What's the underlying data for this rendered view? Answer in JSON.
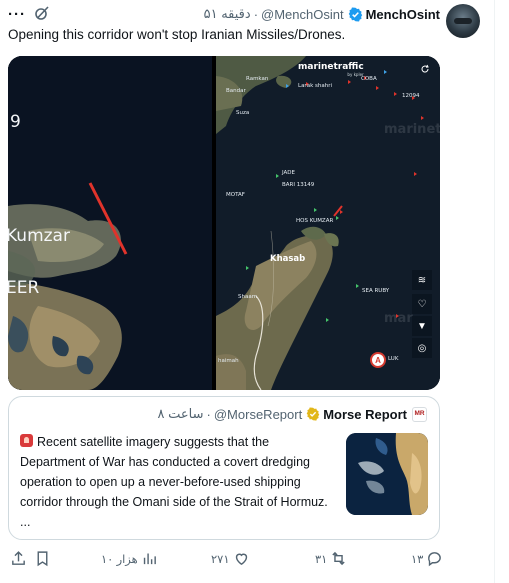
{
  "author": {
    "name": "MenchOsint",
    "handle": "@MenchOsint",
    "time": "۵۱ دقیقه",
    "separator": "·"
  },
  "more_label": "···",
  "tweet_text": "Opening this corridor won't stop Iranian Missiles/Drones.",
  "media": {
    "left": {
      "labels": [
        "9",
        "Kumzar",
        "EER"
      ]
    },
    "right": {
      "brand": "marinetraffic",
      "brand_sub": "by kpler",
      "watermark_top": "marinet",
      "watermark_bottom": "mar",
      "vessel_labels": [
        "COBA",
        "Larak shahri",
        "12094",
        "JADE",
        "BARI 13149",
        "MOTAF",
        "HOS KUMZAR",
        "Khasab",
        "SEA RUBY",
        "LUK"
      ],
      "place_labels": [
        "Ramkan",
        "Bandar",
        "Suza",
        "Shaam",
        "haimah"
      ]
    }
  },
  "quote": {
    "name": "Morse Report",
    "handle": "@MorseReport",
    "time": "۸ ساعت",
    "separator": "·",
    "logo_text": "MR",
    "lines": [
      "Recent satellite imagery suggests that the",
      "Department of War has conducted a covert dredging",
      "operation to open up a never-before-used shipping",
      "corridor through the Omani side of the Strait of Hormuz.",
      "..."
    ]
  },
  "actions": {
    "views": "۱۰ هزار",
    "likes": "۲۷۱",
    "reposts": "۳۱",
    "replies": "۱۳"
  },
  "colors": {
    "verified_blue": "#1d9bf0",
    "gold_badge": "#e2b719",
    "text_secondary": "#536471",
    "marker_red": "#e0332b"
  },
  "icons": {
    "more": "more-icon",
    "grok": "grok-icon",
    "verified": "verified-badge-icon",
    "share": "share-icon",
    "bookmark": "bookmark-icon",
    "views": "views-icon",
    "like": "heart-icon",
    "repost": "repost-icon",
    "reply": "reply-icon"
  }
}
